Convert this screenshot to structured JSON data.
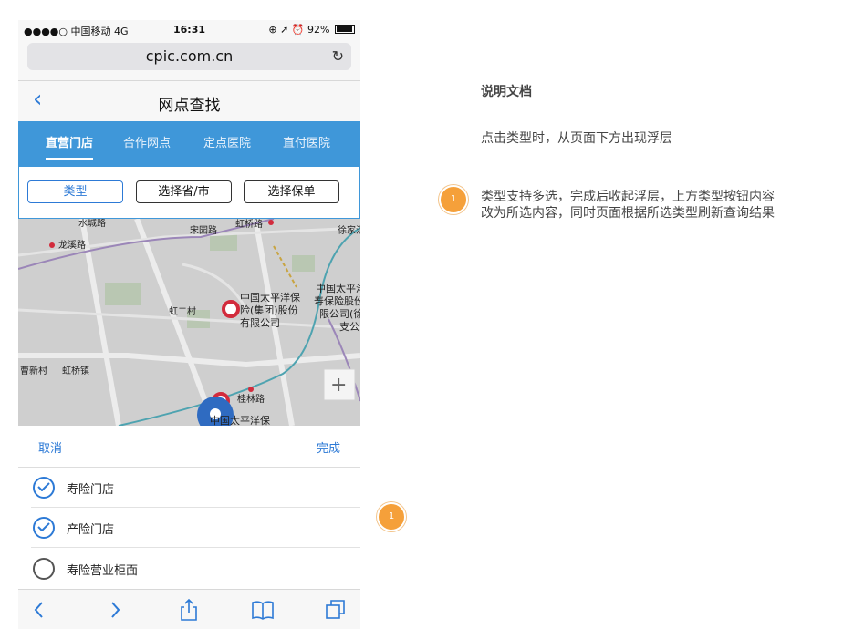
{
  "status_bar": {
    "carrier": "●●●●○ 中国移动 4G",
    "time": "16:31",
    "battery": "92%",
    "battery_level": 0.92
  },
  "browser": {
    "url": "cpic.com.cn"
  },
  "nav": {
    "title": "网点查找"
  },
  "tabs": [
    {
      "label": "直营门店",
      "active": true
    },
    {
      "label": "合作网点",
      "active": false
    },
    {
      "label": "定点医院",
      "active": false
    },
    {
      "label": "直付医院",
      "active": false
    }
  ],
  "filters": [
    {
      "label": "类型",
      "selected": true
    },
    {
      "label": "选择省/市",
      "selected": false
    },
    {
      "label": "选择保单",
      "selected": false
    }
  ],
  "map": {
    "labels": {
      "n1": "水城路",
      "n2": "虹桥路",
      "n3": "宋园路",
      "n4": "徐家汇",
      "n5": "龙溪路",
      "n6": "中国太平洋保",
      "n7": "险(集团)股份",
      "n8": "有限公司",
      "n9": "中国太平洋",
      "n10": "寿保险股份",
      "n11": "限公司(徐",
      "n12": "支公",
      "n13": "虹二村",
      "n14": "虹桥镇",
      "n15": "桂林路",
      "n16": "中国太平洋保",
      "n17": "曹新村",
      "n18": "+"
    }
  },
  "sheet": {
    "cancel": "取消",
    "done": "完成",
    "options": [
      {
        "label": "寿险门店",
        "checked": true
      },
      {
        "label": "产险门店",
        "checked": true
      },
      {
        "label": "寿险营业柜面",
        "checked": false
      }
    ]
  },
  "doc": {
    "title": "说明文档",
    "desc": "点击类型时，从页面下方出现浮层",
    "note_line1": "类型支持多选，完成后收起浮层，上方类型按钮内容",
    "note_line2": "改为所选内容，同时页面根据所选类型刷新查询结果",
    "badge1": "1",
    "badge2": "1"
  },
  "colors": {
    "accent": "#3f97d9",
    "link": "#2d7ad6",
    "badge": "#f5a03a",
    "pin": "#d22b3c"
  }
}
